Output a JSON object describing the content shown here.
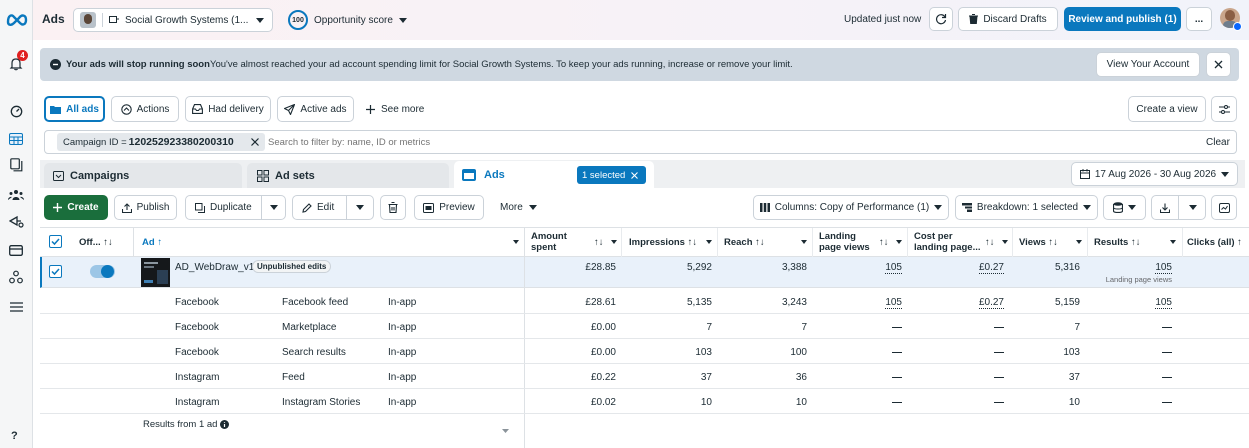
{
  "app": {
    "title": "Ads"
  },
  "topbar": {
    "account_name": "Social Growth Systems (1...",
    "opportunity_score": "100",
    "opportunity_label": "Opportunity score",
    "updated": "Updated just now",
    "discard": "Discard Drafts",
    "review": "Review and publish (1)",
    "more": "..."
  },
  "notifications": {
    "count": "4"
  },
  "banner": {
    "title": "Your ads will stop running soon",
    "text": "You've almost reached your ad account spending limit for Social Growth Systems. To keep your ads running, increase or remove your limit.",
    "button": "View Your Account"
  },
  "filters": {
    "tabs": [
      "All ads",
      "Actions",
      "Had delivery",
      "Active ads"
    ],
    "see_more": "See more",
    "create_view": "Create a view"
  },
  "search": {
    "chip_label": "Campaign ID = ",
    "chip_value": "120252923380200310",
    "placeholder": "Search to filter by: name, ID or metrics",
    "clear": "Clear"
  },
  "level_tabs": {
    "campaigns": "Campaigns",
    "adsets": "Ad sets",
    "ads": "Ads",
    "selected": "1 selected",
    "date_range": "17 Aug 2026 - 30 Aug 2026"
  },
  "toolbar": {
    "create": "Create",
    "publish": "Publish",
    "duplicate": "Duplicate",
    "edit": "Edit",
    "preview": "Preview",
    "more": "More",
    "columns": "Columns: Copy of Performance (1)",
    "breakdown": "Breakdown: 1 selected"
  },
  "table": {
    "headers": {
      "off": "Off...",
      "ad": "Ad",
      "amount": "Amount spent",
      "impressions": "Impressions",
      "reach": "Reach",
      "landing": "Landing page views",
      "cost": "Cost per landing page...",
      "views": "Views",
      "results": "Results",
      "clicks": "Clicks (all)"
    },
    "main_row": {
      "name": "AD_WebDraw_v1",
      "badge": "Unpublished edits",
      "amount": "£28.85",
      "impressions": "5,292",
      "reach": "3,388",
      "landing": "105",
      "cost": "£0.27",
      "views": "5,316",
      "results": "105",
      "results_sub": "Landing page views"
    },
    "rows": [
      {
        "platform": "Facebook",
        "placement": "Facebook feed",
        "device": "In-app",
        "amount": "£28.61",
        "impressions": "5,135",
        "reach": "3,243",
        "landing": "105",
        "cost": "£0.27",
        "views": "5,159",
        "results": "105"
      },
      {
        "platform": "Facebook",
        "placement": "Marketplace",
        "device": "In-app",
        "amount": "£0.00",
        "impressions": "7",
        "reach": "7",
        "landing": "",
        "cost": "",
        "views": "7",
        "results": ""
      },
      {
        "platform": "Facebook",
        "placement": "Search results",
        "device": "In-app",
        "amount": "£0.00",
        "impressions": "103",
        "reach": "100",
        "landing": "",
        "cost": "",
        "views": "103",
        "results": ""
      },
      {
        "platform": "Instagram",
        "placement": "Feed",
        "device": "In-app",
        "amount": "£0.22",
        "impressions": "37",
        "reach": "36",
        "landing": "",
        "cost": "",
        "views": "37",
        "results": ""
      },
      {
        "platform": "Instagram",
        "placement": "Instagram Stories",
        "device": "In-app",
        "amount": "£0.02",
        "impressions": "10",
        "reach": "10",
        "landing": "",
        "cost": "",
        "views": "10",
        "results": ""
      }
    ],
    "footer": "Results from 1 ad"
  },
  "sidebar": {
    "help": "?"
  },
  "colors": {
    "accent": "#0a78be",
    "create": "#1a6e3c",
    "danger": "#e02020",
    "banner": "#cfd8e1"
  }
}
